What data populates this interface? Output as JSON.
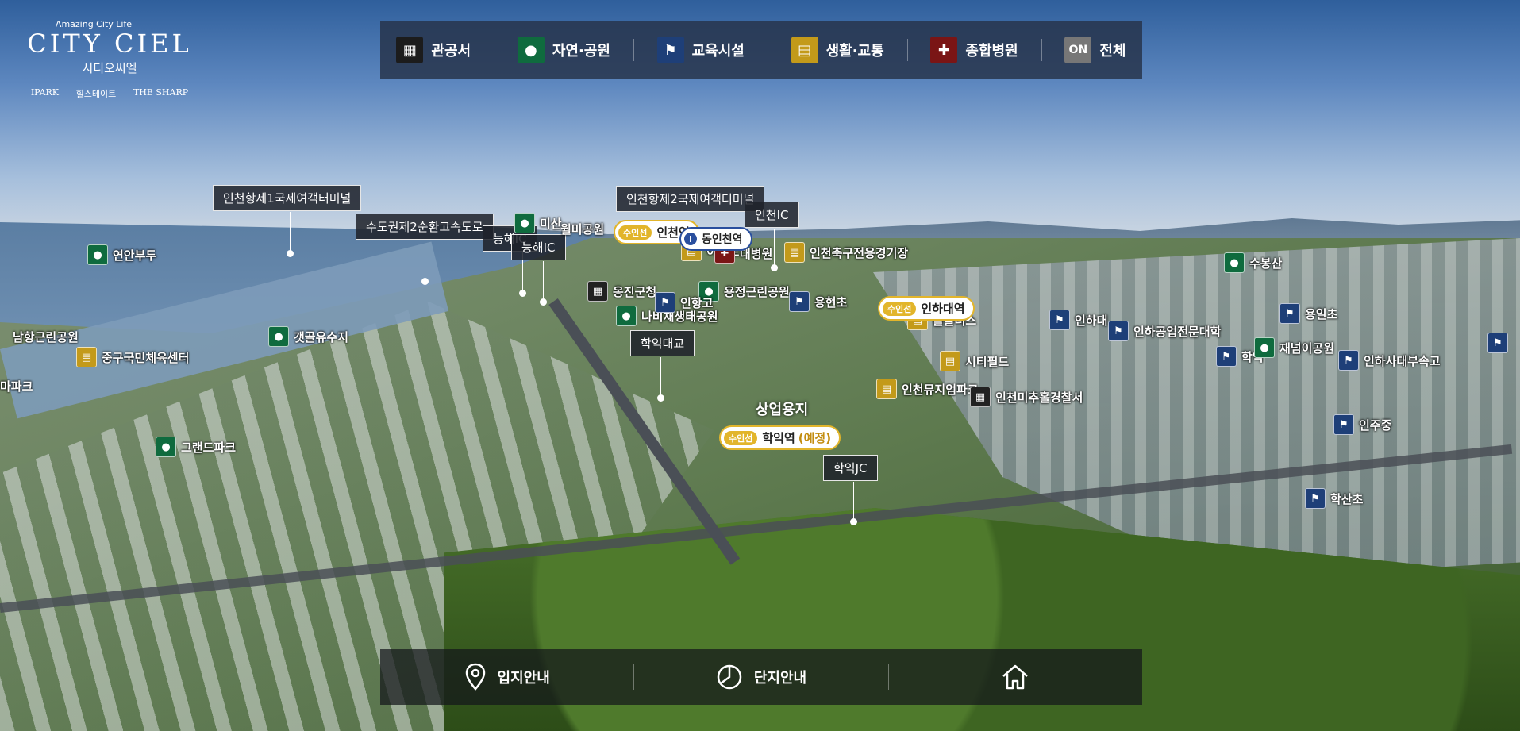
{
  "logo": {
    "tagline": "Amazing City Life",
    "brand": "CITY CIEL",
    "korean": "시티오씨엘",
    "partners": [
      "IPARK",
      "힐스테이트",
      "THE SHARP"
    ]
  },
  "topnav": {
    "items": [
      {
        "label": "관공서",
        "icon": "building-icon",
        "color": "#1c1c1c"
      },
      {
        "label": "자연·공원",
        "icon": "tree-icon",
        "color": "#0f6b3e"
      },
      {
        "label": "교육시설",
        "icon": "school-icon",
        "color": "#1e3f78"
      },
      {
        "label": "생활·교통",
        "icon": "shop-icon",
        "color": "#c39a1a"
      },
      {
        "label": "종합병원",
        "icon": "hospital-cross-icon",
        "color": "#7a1515"
      },
      {
        "label": "전체",
        "icon_text": "ON",
        "icon": "all-on-icon",
        "color": "#777777"
      }
    ]
  },
  "callouts": {
    "terminal1": "인천항제1국제여객터미널",
    "expressway": "수도권제2순환고속도로",
    "terminal2": "인천항제2국제여객터미널",
    "incheon_ic": "인천IC",
    "neunghae_ic": "능해IC",
    "neunghae_ic_back": "능해IC",
    "hagik_bridge": "학익대교",
    "hagik_jc": "학익JC"
  },
  "pois": {
    "yeonan_pier": "연안부두",
    "namhang_park": "남항근린공원",
    "junggu_gym": "중구국민체육센터",
    "park_left": "마파크",
    "gaetgol": "갯골유수지",
    "grand_park": "그랜드파크",
    "wolmi_park": "월미공원",
    "wolmi_mountain": "미산",
    "yongjin_office": "옹진군청",
    "nabi_park": "나비채생태공원",
    "emart": "이마트",
    "hospital": "대병원",
    "incheon_stadium": "인천축구전용경기장",
    "yongjeong_park": "용정근린공원",
    "yonghyeon": "용현초",
    "incheon_go": "인항고",
    "hollus": "홀플러스",
    "city_field": "시티필드",
    "museum_park": "인천뮤지엄파크",
    "police": "인천미추홀경찰서",
    "subongsan": "수봉산",
    "inha_mid": "인하대",
    "inha_college": "인하공업전문대학",
    "yongil": "용일초",
    "jaenaei_park": "재넘이공원",
    "inha_highschool": "인하사대부속고",
    "inju_mid": "인주중",
    "haksan": "학산초",
    "hakik": "학익"
  },
  "stations": {
    "incheon_station": {
      "line": "수인선",
      "name": "인천역"
    },
    "inha_station": {
      "line": "수인선",
      "name": "인하대역"
    },
    "hagik_station": {
      "line": "수인선",
      "name": "학익역",
      "plan": "(예정)"
    },
    "dongincheon": "동인천역"
  },
  "zone": "상업용지",
  "bottomnav": {
    "location": "입지안내",
    "complex": "단지안내"
  }
}
